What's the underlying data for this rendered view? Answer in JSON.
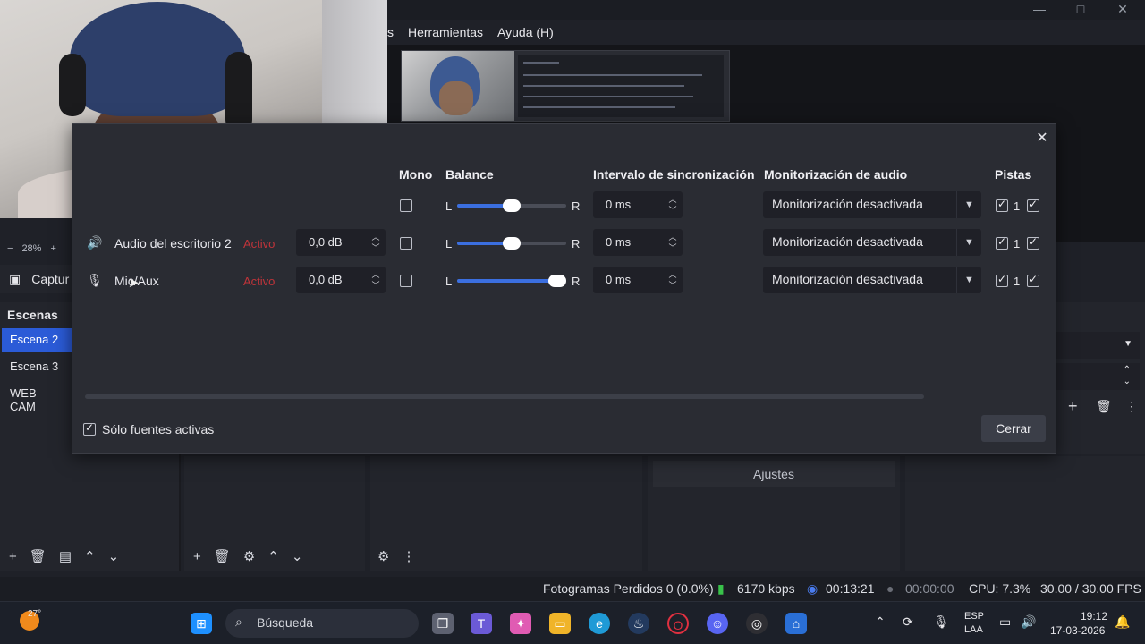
{
  "menu": {
    "partial": "s",
    "tools": "Herramientas",
    "help": "Ayuda (H)"
  },
  "window_controls": {
    "minimize": "—",
    "maximize": "□",
    "close": "✕"
  },
  "zoom": {
    "minus": "−",
    "value": "28%",
    "plus": "+"
  },
  "source_toolbar": {
    "capture_label": "Captur"
  },
  "scenes": {
    "title": "Escenas",
    "items": [
      {
        "label": "Escena 2",
        "selected": true
      },
      {
        "label": "Escena 3",
        "selected": false
      },
      {
        "label": "WEB CAM",
        "selected": false
      }
    ]
  },
  "controls": {
    "settings_label": "Ajustes"
  },
  "dialog": {
    "headers": {
      "mono": "Mono",
      "balance": "Balance",
      "sync": "Intervalo de sincronización",
      "monitor": "Monitorización de audio",
      "tracks": "Pistas"
    },
    "rows": [
      {
        "icon": "speaker-icon",
        "name": "Audio del escritorio 2",
        "status": "Activo",
        "volume": "0,0 dB",
        "mono": false,
        "balance_left": "L",
        "balance_right": "R",
        "balance": 0.5,
        "sync": "0 ms",
        "monitor": "Monitorización desactivada",
        "track1": "1"
      },
      {
        "icon": "microphone-icon",
        "name": "Mic/Aux",
        "status": "Activo",
        "volume": "0,0 dB",
        "mono": false,
        "balance_left": "L",
        "balance_right": "R",
        "balance": 0.5,
        "sync": "0 ms",
        "monitor": "Monitorización desactivada",
        "track1": "1"
      },
      {
        "icon": "microphone-icon",
        "name": "Mic/Aux",
        "status": "Activo",
        "volume": "0,0 dB",
        "mono": false,
        "balance_left": "L",
        "balance_right": "R",
        "balance": 1.0,
        "sync": "0 ms",
        "monitor": "Monitorización desactivada",
        "track1": "1"
      }
    ],
    "only_active_label": "Sólo fuentes activas",
    "only_active_checked": true,
    "close_label": "Cerrar"
  },
  "statusbar": {
    "dropped_frames": "Fotogramas Perdidos 0 (0.0%)",
    "bitrate": "6170 kbps",
    "stream_time": "00:13:21",
    "record_time": "00:00:00",
    "cpu": "CPU: 7.3%",
    "fps": "30.00 / 30.00 FPS"
  },
  "taskbar": {
    "temperature": "27°",
    "search_placeholder": "Búsqueda",
    "language_line1": "ESP",
    "language_line2": "LAA",
    "time": "19:12",
    "date": "17-03-2026"
  },
  "colors": {
    "accent": "#2b5bd7",
    "slider_fill": "#3b6fe0",
    "status_active": "#c0343a",
    "bitrate_green": "#39c24a",
    "stream_blue": "#4a7cf0"
  }
}
